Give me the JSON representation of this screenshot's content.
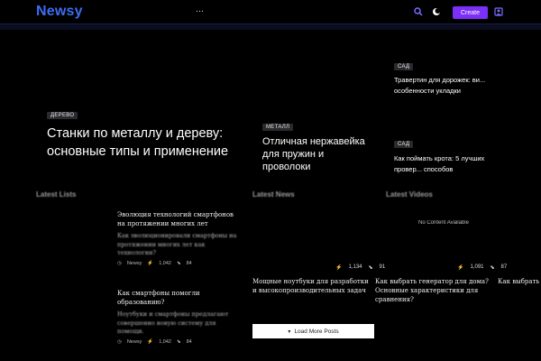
{
  "header": {
    "logo": "Newsy",
    "menu_icon": "…",
    "create_label": "Create"
  },
  "featured": {
    "big": {
      "tag": "ДЕРЕВО",
      "title": "Станки по металлу и дереву: основные типы и применение"
    },
    "mid": {
      "tag": "МЕТАЛЛ",
      "title": "Отличная нержавейка для пружин и проволоки"
    },
    "side1": {
      "tag": "САД",
      "title": "Травертин для дорожек: ви... особенности укладки"
    },
    "side2": {
      "tag": "САД",
      "title": "Как поймать крота: 5 лучших провер... способов"
    }
  },
  "sections": {
    "lists": "Latest Lists",
    "news": "Latest News",
    "videos": "Latest Videos"
  },
  "lists": [
    {
      "title": "Эволюция технологий смартфонов на протяжении многих лет",
      "excerpt": "Как эволюционировали смартфоны на протяжении многих лет как технологии?",
      "author": "Newsy",
      "views": "1,042",
      "votes": "84"
    },
    {
      "title": "Как смартфоны помогли образованию?",
      "excerpt": "Ноутбуки и смартфоны предлагают совершенно новую систему для помощи.",
      "author": "Newsy",
      "views": "1,042",
      "votes": "84"
    }
  ],
  "news": {
    "views": "1,134",
    "votes": "91",
    "items": [
      "Мощные ноутбуки для разработки и высокопроизводительных задач",
      "Как выбрать генератор для дома? Основные характеристики для сравнения?",
      "Как выбрать ..."
    ]
  },
  "videos": {
    "empty_label": "No Content Available",
    "views": "1,091",
    "votes": "87"
  },
  "load_more_label": "Load More Posts"
}
